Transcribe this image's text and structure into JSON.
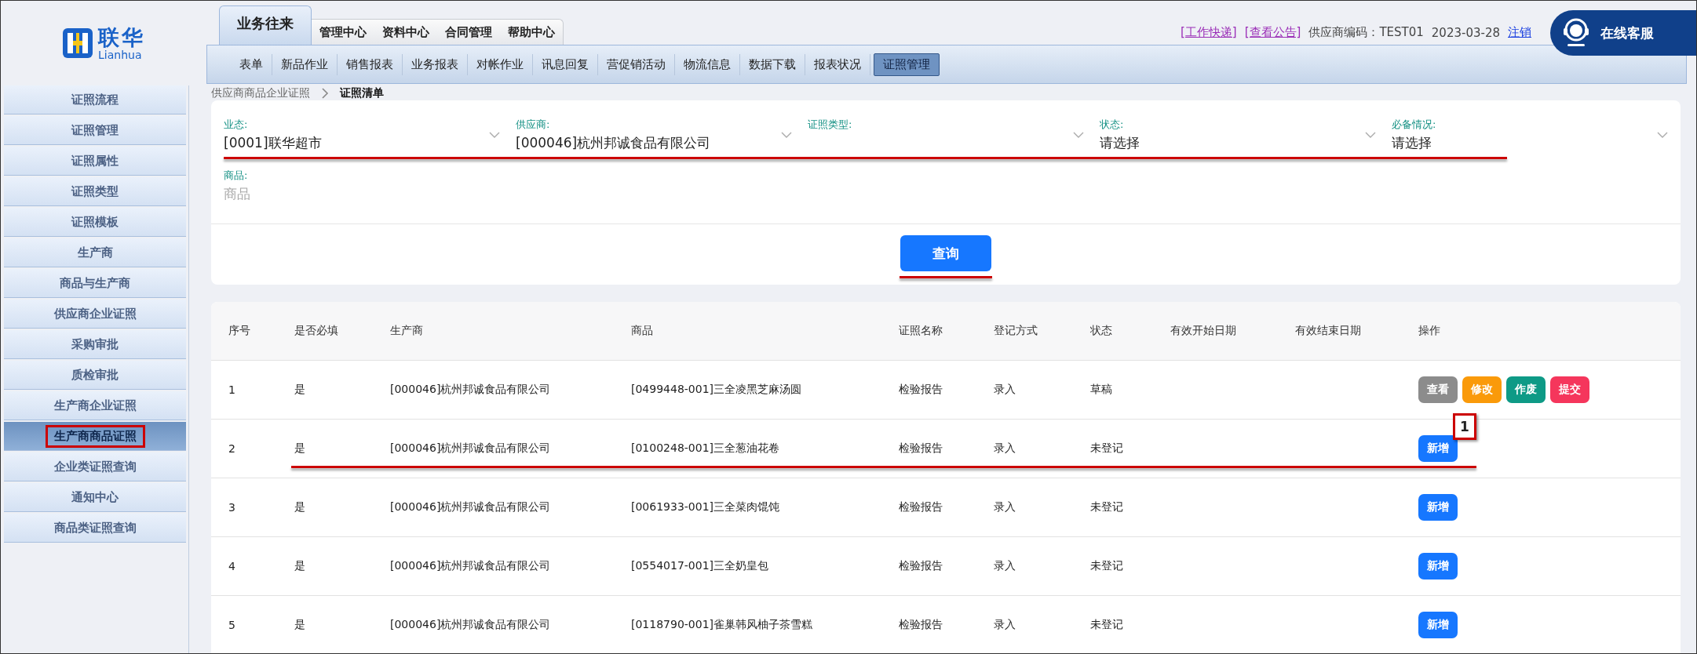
{
  "logo": {
    "name": "联华",
    "sub": "Lianhua"
  },
  "top_tabs": [
    {
      "label": "业务往来",
      "selected": true
    },
    {
      "label": "管理中心",
      "selected": false
    },
    {
      "label": "资料中心",
      "selected": false
    },
    {
      "label": "合同管理",
      "selected": false
    },
    {
      "label": "帮助中心",
      "selected": false
    }
  ],
  "header": {
    "links": [
      "[工作快递]",
      "[查看公告]"
    ],
    "supplier_code": "供应商编码：TEST01",
    "date": "2023-03-28",
    "logout": "注销",
    "service_button": "在线客服"
  },
  "sub_nav": [
    {
      "label": "表单",
      "selected": false
    },
    {
      "label": "新品作业",
      "selected": false
    },
    {
      "label": "销售报表",
      "selected": false
    },
    {
      "label": "业务报表",
      "selected": false
    },
    {
      "label": "对帐作业",
      "selected": false
    },
    {
      "label": "讯息回复",
      "selected": false
    },
    {
      "label": "营促销活动",
      "selected": false
    },
    {
      "label": "物流信息",
      "selected": false
    },
    {
      "label": "数据下载",
      "selected": false
    },
    {
      "label": "报表状况",
      "selected": false
    },
    {
      "label": "证照管理",
      "selected": true
    }
  ],
  "sidebar": {
    "items": [
      {
        "label": "证照流程",
        "selected": false,
        "annotated": false
      },
      {
        "label": "证照管理",
        "selected": false,
        "annotated": false
      },
      {
        "label": "证照属性",
        "selected": false,
        "annotated": false
      },
      {
        "label": "证照类型",
        "selected": false,
        "annotated": false
      },
      {
        "label": "证照模板",
        "selected": false,
        "annotated": false
      },
      {
        "label": "生产商",
        "selected": false,
        "annotated": false
      },
      {
        "label": "商品与生产商",
        "selected": false,
        "annotated": false
      },
      {
        "label": "供应商企业证照",
        "selected": false,
        "annotated": false
      },
      {
        "label": "采购审批",
        "selected": false,
        "annotated": false
      },
      {
        "label": "质检审批",
        "selected": false,
        "annotated": false
      },
      {
        "label": "生产商企业证照",
        "selected": false,
        "annotated": false
      },
      {
        "label": "生产商商品证照",
        "selected": true,
        "annotated": true
      },
      {
        "label": "企业类证照查询",
        "selected": false,
        "annotated": false
      },
      {
        "label": "通知中心",
        "selected": false,
        "annotated": false
      },
      {
        "label": "商品类证照查询",
        "selected": false,
        "annotated": false
      }
    ]
  },
  "breadcrumb": [
    "供应商商品企业证照",
    "证照清单"
  ],
  "filters": {
    "underlined": true,
    "fields": [
      {
        "kind": "select",
        "label": "业态:",
        "value": "[0001]联华超市"
      },
      {
        "kind": "select",
        "label": "供应商:",
        "value": "[000046]杭州邦诚食品有限公司"
      },
      {
        "kind": "select",
        "label": "证照类型:"
      },
      {
        "kind": "select",
        "label": "状态:",
        "value": "请选择"
      },
      {
        "kind": "select",
        "label": "必备情况:",
        "value": "请选择"
      },
      {
        "kind": "text",
        "label": "商品:",
        "placeholder": "商品"
      }
    ],
    "query_button": {
      "label": "查询",
      "underlined": true
    }
  },
  "table": {
    "columns": [
      "序号",
      "是否必填",
      "生产商",
      "商品",
      "证照名称",
      "登记方式",
      "状态",
      "有效开始日期",
      "有效结束日期",
      "操作"
    ],
    "rows": [
      {
        "cells": [
          "1",
          "是",
          "[000046]杭州邦诚食品有限公司",
          "[0499448-001]三全凌黑芝麻汤圆",
          "检验报告",
          "录入",
          "草稿"
        ],
        "underlined": false,
        "actions": [
          {
            "label": "查看",
            "color": "#8c8c8c"
          },
          {
            "label": "修改",
            "color": "#fa9a0a"
          },
          {
            "label": "作废",
            "color": "#0e9a86"
          },
          {
            "label": "提交",
            "color": "#f5365c"
          }
        ]
      },
      {
        "cells": [
          "2",
          "是",
          "[000046]杭州邦诚食品有限公司",
          "[0100248-001]三全葱油花卷",
          "检验报告",
          "录入",
          "未登记"
        ],
        "underlined": true,
        "callout": "1",
        "actions": [
          {
            "label": "新增",
            "color": "#1677ff"
          }
        ]
      },
      {
        "cells": [
          "3",
          "是",
          "[000046]杭州邦诚食品有限公司",
          "[0061933-001]三全菜肉馄饨",
          "检验报告",
          "录入",
          "未登记"
        ],
        "underlined": false,
        "actions": [
          {
            "label": "新增",
            "color": "#1677ff"
          }
        ]
      },
      {
        "cells": [
          "4",
          "是",
          "[000046]杭州邦诚食品有限公司",
          "[0554017-001]三全奶皇包",
          "检验报告",
          "录入",
          "未登记"
        ],
        "underlined": false,
        "actions": [
          {
            "label": "新增",
            "color": "#1677ff"
          }
        ]
      },
      {
        "cells": [
          "5",
          "是",
          "[000046]杭州邦诚食品有限公司",
          "[0118790-001]雀巢韩风柚子茶雪糕",
          "检验报告",
          "录入",
          "未登记"
        ],
        "underlined": false,
        "actions": [
          {
            "label": "新增",
            "color": "#1677ff"
          }
        ]
      }
    ]
  }
}
